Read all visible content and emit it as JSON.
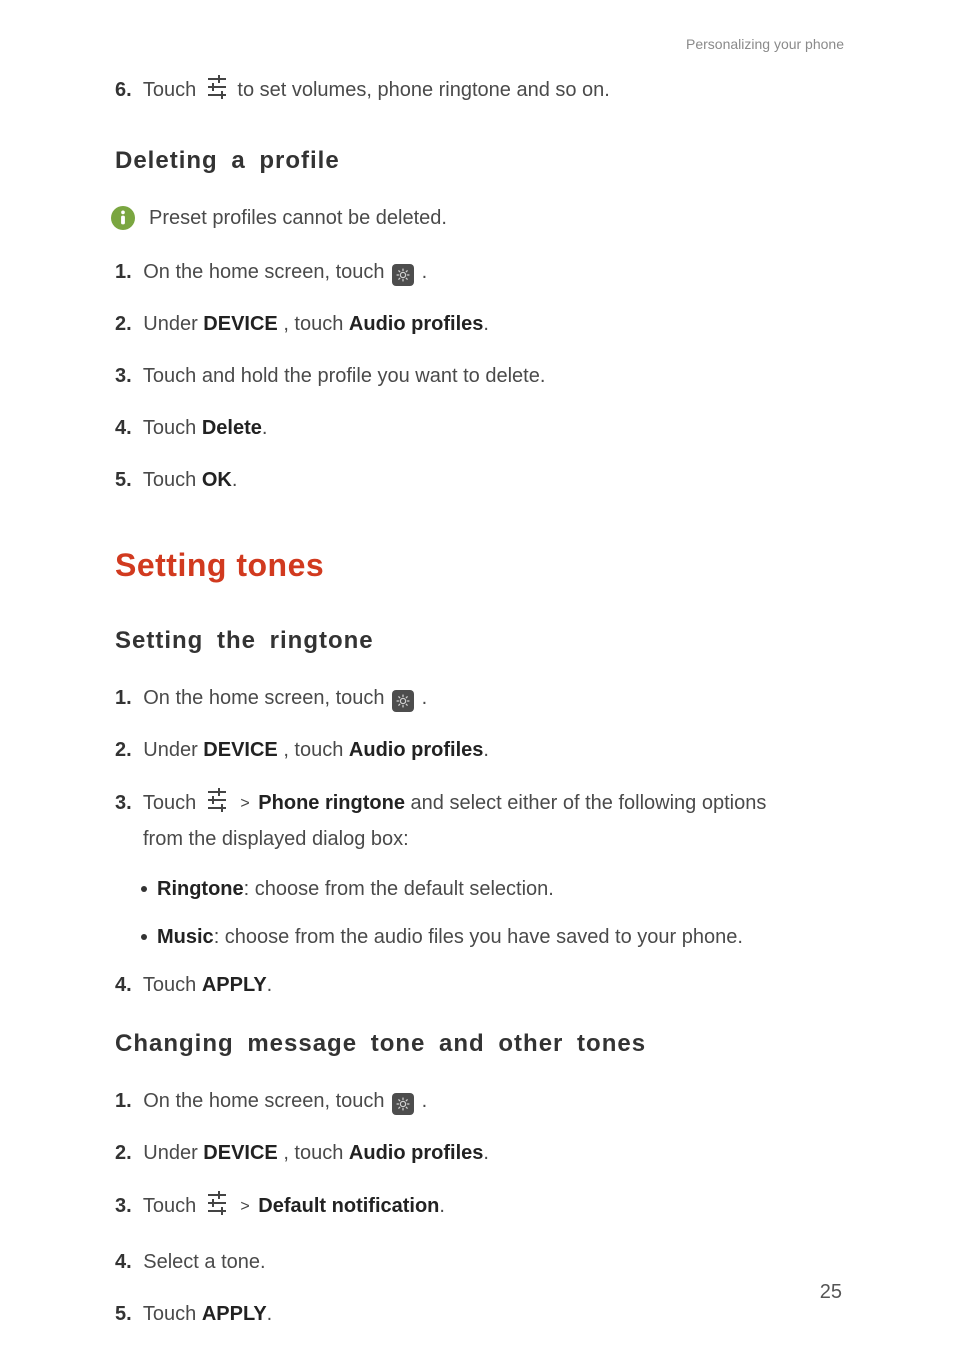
{
  "running_head": "Personalizing your phone",
  "page_number": "25",
  "intro_step": {
    "num": "6.",
    "pre": "Touch ",
    "post": " to set volumes, phone ringtone and so on."
  },
  "deleting": {
    "heading": "Deleting  a  profile",
    "info": "Preset profiles cannot be deleted.",
    "steps": {
      "s1": {
        "num": "1.",
        "pre": "On the home screen, touch ",
        "post": " ."
      },
      "s2": {
        "num": "2.",
        "pre": "Under ",
        "b1": "DEVICE",
        "mid": ", touch ",
        "b2": "Audio profiles",
        "post": "."
      },
      "s3": {
        "num": "3.",
        "text": "Touch and hold the profile you want to delete."
      },
      "s4": {
        "num": "4.",
        "pre": "Touch ",
        "b1": "Delete",
        "post": "."
      },
      "s5": {
        "num": "5.",
        "pre": "Touch ",
        "b1": "OK",
        "post": "."
      }
    }
  },
  "section_heading": "Setting tones",
  "ringtone": {
    "heading": "Setting  the  ringtone",
    "steps": {
      "s1": {
        "num": "1.",
        "pre": "On the home screen, touch ",
        "post": " ."
      },
      "s2": {
        "num": "2.",
        "pre": "Under ",
        "b1": "DEVICE",
        "mid": ", touch ",
        "b2": "Audio profiles",
        "post": "."
      },
      "s3": {
        "num": "3.",
        "pre": "Touch ",
        "gt": ">",
        "b1": "Phone ringtone",
        "post": " and select either of the following options ",
        "cont": "from the displayed dialog box:"
      },
      "bul1": {
        "b": "Ringtone",
        "rest": ": choose from the default selection."
      },
      "bul2": {
        "b": "Music",
        "rest": ": choose from the audio files you have saved to your phone."
      },
      "s4": {
        "num": "4.",
        "pre": "Touch ",
        "b1": "APPLY",
        "post": "."
      }
    }
  },
  "msgtone": {
    "heading": "Changing  message  tone  and  other  tones",
    "steps": {
      "s1": {
        "num": "1.",
        "pre": "On the home screen, touch ",
        "post": " ."
      },
      "s2": {
        "num": "2.",
        "pre": "Under ",
        "b1": "DEVICE",
        "mid": ", touch ",
        "b2": "Audio profiles",
        "post": "."
      },
      "s3": {
        "num": "3.",
        "pre": "Touch ",
        "gt": ">",
        "b1": "Default notification",
        "post": "."
      },
      "s4": {
        "num": "4.",
        "text": "Select a tone."
      },
      "s5": {
        "num": "5.",
        "pre": "Touch ",
        "b1": "APPLY",
        "post": "."
      }
    }
  }
}
